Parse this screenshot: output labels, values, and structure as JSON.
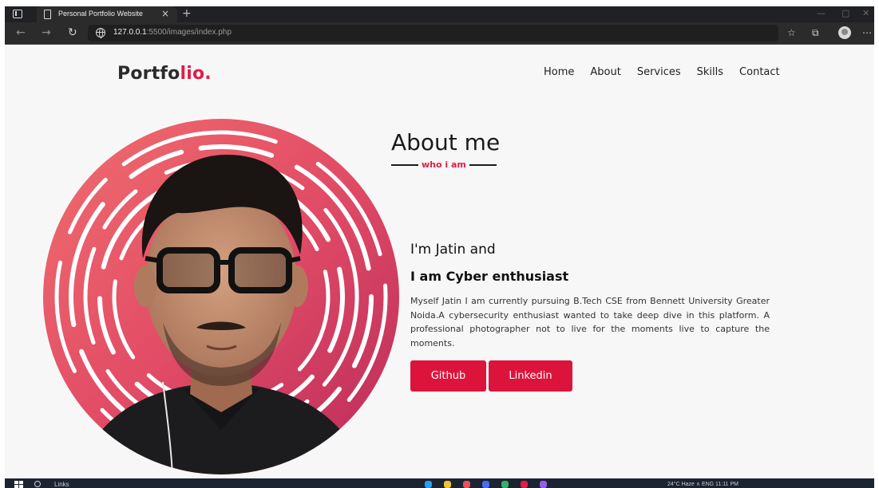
{
  "browser": {
    "tab_title": "Personal Portfolio Website",
    "tab_close": "×",
    "new_tab": "+",
    "url_host": "127.0.0.1",
    "url_path": ":5500/images/index.php",
    "window_controls": {
      "minimize": "—",
      "restore": "▢",
      "close": "✕"
    },
    "icons": [
      "back-icon",
      "forward-icon",
      "refresh-icon",
      "site-info-icon",
      "favorites-icon",
      "collections-icon",
      "profile-icon",
      "more-icon"
    ]
  },
  "site": {
    "logo_main": "Portfo",
    "logo_accent": "lio.",
    "accent_color": "#e11d48",
    "nav": [
      "Home",
      "About",
      "Services",
      "Skills",
      "Contact"
    ]
  },
  "about": {
    "title": "About me",
    "subtitle": "who i am",
    "intro": "I'm Jatin and",
    "role": "I am Cyber enthusiast",
    "bio": "Myself Jatin I am currently pursuing B.Tech CSE from Bennett University Greater Noida.A cybersecurity enthusiast wanted to take deep dive in this platform. A professional photographer not to live for the moments live to capture the moments.",
    "buttons": {
      "github": "Github",
      "linkedin": "Linkedin"
    },
    "button_color": "#dc143c"
  },
  "taskbar": {
    "search_label": "Links",
    "tray": "24°C Haze  ∧  ENG  11:11 PM"
  }
}
